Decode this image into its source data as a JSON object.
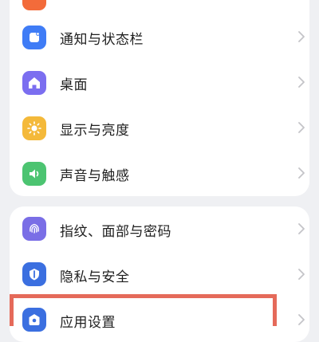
{
  "settings": {
    "group1": [
      {
        "label": "",
        "icon": "partial-orange-icon",
        "color": "#f36b3a"
      },
      {
        "label": "通知与状态栏",
        "icon": "notification-status-bar-icon",
        "color": "#3f7cf6"
      },
      {
        "label": "桌面",
        "icon": "home-icon",
        "color": "#7b6ef0"
      },
      {
        "label": "显示与亮度",
        "icon": "sun-icon",
        "color": "#f4b93a"
      },
      {
        "label": "声音与触感",
        "icon": "speaker-icon",
        "color": "#4cc471"
      }
    ],
    "group2": [
      {
        "label": "指纹、面部与密码",
        "icon": "fingerprint-icon",
        "color": "#7a6ee6"
      },
      {
        "label": "隐私与安全",
        "icon": "privacy-shield-icon",
        "color": "#3b6fe0"
      },
      {
        "label": "应用设置",
        "icon": "app-settings-icon",
        "color": "#3b6fe0"
      }
    ],
    "highlight_color": "#e56a5a"
  }
}
